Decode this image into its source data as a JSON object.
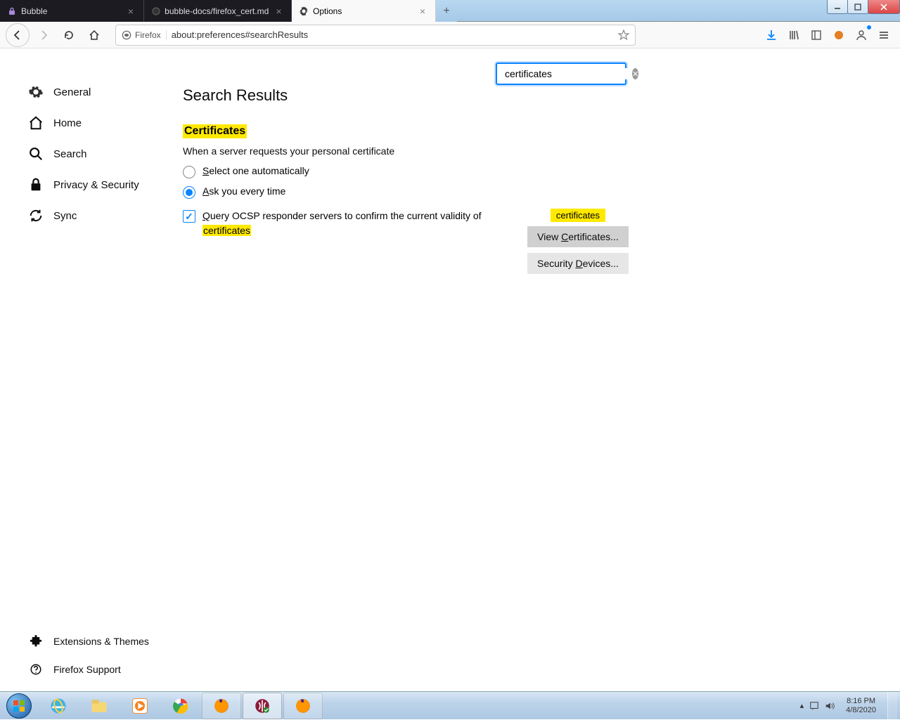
{
  "tabs": [
    {
      "label": "Bubble",
      "active": false
    },
    {
      "label": "bubble-docs/firefox_cert.md a",
      "active": false
    },
    {
      "label": "Options",
      "active": true
    }
  ],
  "addressbar": {
    "identity": "Firefox",
    "url": "about:preferences#searchResults"
  },
  "sidebar": {
    "items": [
      {
        "label": "General"
      },
      {
        "label": "Home"
      },
      {
        "label": "Search"
      },
      {
        "label": "Privacy & Security"
      },
      {
        "label": "Sync"
      }
    ],
    "bottom": [
      {
        "label": "Extensions & Themes"
      },
      {
        "label": "Firefox Support"
      }
    ]
  },
  "searchbox": {
    "value": "certificates"
  },
  "page": {
    "title": "Search Results",
    "section_heading": "Certificates",
    "section_sub": "When a server requests your personal certificate",
    "radio1_prefix": "S",
    "radio1_rest": "elect one automatically",
    "radio2_prefix": "A",
    "radio2_rest": "sk you every time",
    "check_prefix": "Q",
    "check_mid": "uery OCSP responder servers to confirm the current validity of ",
    "check_highlight": "certificates"
  },
  "tooltip": "certificates",
  "buttons": {
    "view_pre": "View ",
    "view_key": "C",
    "view_post": "ertificates...",
    "sec_pre": "Security ",
    "sec_key": "D",
    "sec_post": "evices..."
  },
  "clock": {
    "time": "8:16 PM",
    "date": "4/8/2020"
  }
}
